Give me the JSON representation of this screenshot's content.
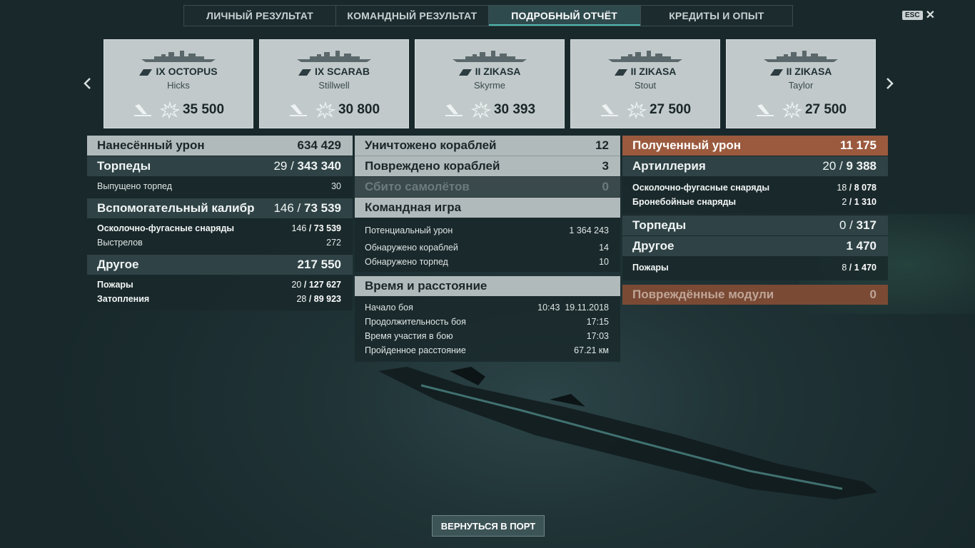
{
  "tabs": [
    {
      "label": "ЛИЧНЫЙ РЕЗУЛЬТАТ"
    },
    {
      "label": "КОМАНДНЫЙ РЕЗУЛЬТАТ"
    },
    {
      "label": "ПОДРОБНЫЙ ОТЧЁТ",
      "active": true
    },
    {
      "label": "КРЕДИТЫ И ОПЫТ"
    }
  ],
  "esc_label": "ESC",
  "cards": [
    {
      "ship": "IX OCTOPUS",
      "player": "Hicks",
      "score": "35 500"
    },
    {
      "ship": "IX SCARAB",
      "player": "Stillwell",
      "score": "30 800"
    },
    {
      "ship": "II ZIKASA",
      "player": "Skyrme",
      "score": "30 393"
    },
    {
      "ship": "II ZIKASA",
      "player": "Stout",
      "score": "27 500"
    },
    {
      "ship": "II ZIKASA",
      "player": "Taylor",
      "score": "27 500"
    }
  ],
  "dealt": {
    "title": "Нанесённый урон",
    "total": "634 429",
    "torpedoes": {
      "label": "Торпеды",
      "hits": "29",
      "value": "343 340",
      "rows": [
        {
          "label": "Выпущено торпед",
          "value": "30"
        }
      ]
    },
    "secondary": {
      "label": "Вспомогательный калибр",
      "hits": "146",
      "value": "73 539",
      "rows": [
        {
          "label": "Осколочно-фугасные снаряды",
          "hits": "146",
          "value": "73 539"
        },
        {
          "label": "Выстрелов",
          "value": "272"
        }
      ]
    },
    "other": {
      "label": "Другое",
      "value": "217 550",
      "rows": [
        {
          "label": "Пожары",
          "hits": "20",
          "value": "127 627"
        },
        {
          "label": "Затопления",
          "hits": "28",
          "value": "89 923"
        }
      ]
    }
  },
  "middle": {
    "destroyed": {
      "label": "Уничтожено кораблей",
      "value": "12"
    },
    "damaged": {
      "label": "Повреждено кораблей",
      "value": "3"
    },
    "planes": {
      "label": "Сбито самолётов",
      "value": "0"
    },
    "team": {
      "title": "Командная игра",
      "rows": [
        {
          "label": "Потенциальный урон",
          "value": "1 364 243"
        },
        {
          "label": "Обнаружено кораблей",
          "value": "14"
        },
        {
          "label": "Обнаружено торпед",
          "value": "10"
        }
      ]
    },
    "time": {
      "title": "Время и расстояние",
      "rows": [
        {
          "label": "Начало боя",
          "value": "10:43  19.11.2018"
        },
        {
          "label": "Продолжительность боя",
          "value": "17:15"
        },
        {
          "label": "Время участия в бою",
          "value": "17:03"
        },
        {
          "label": "Пройденное расстояние",
          "value": "67.21 км"
        }
      ]
    }
  },
  "received": {
    "title": "Полученный урон",
    "total": "11 175",
    "artillery": {
      "label": "Артиллерия",
      "hits": "20",
      "value": "9 388",
      "rows": [
        {
          "label": "Осколочно-фугасные снаряды",
          "hits": "18",
          "value": "8 078"
        },
        {
          "label": "Бронебойные снаряды",
          "hits": "2",
          "value": "1 310"
        }
      ]
    },
    "torpedoes": {
      "label": "Торпеды",
      "hits": "0",
      "value": "317"
    },
    "other": {
      "label": "Другое",
      "value": "1 470",
      "rows": [
        {
          "label": "Пожары",
          "hits": "8",
          "value": "1 470"
        }
      ]
    },
    "modules": {
      "label": "Повреждённые модули",
      "value": "0"
    }
  },
  "return_button": "ВЕРНУТЬСЯ В ПОРТ",
  "colors": {
    "accent": "#4fb7b0",
    "received_header": "#9b5a3e",
    "card_bg": "#c1c9ca"
  }
}
